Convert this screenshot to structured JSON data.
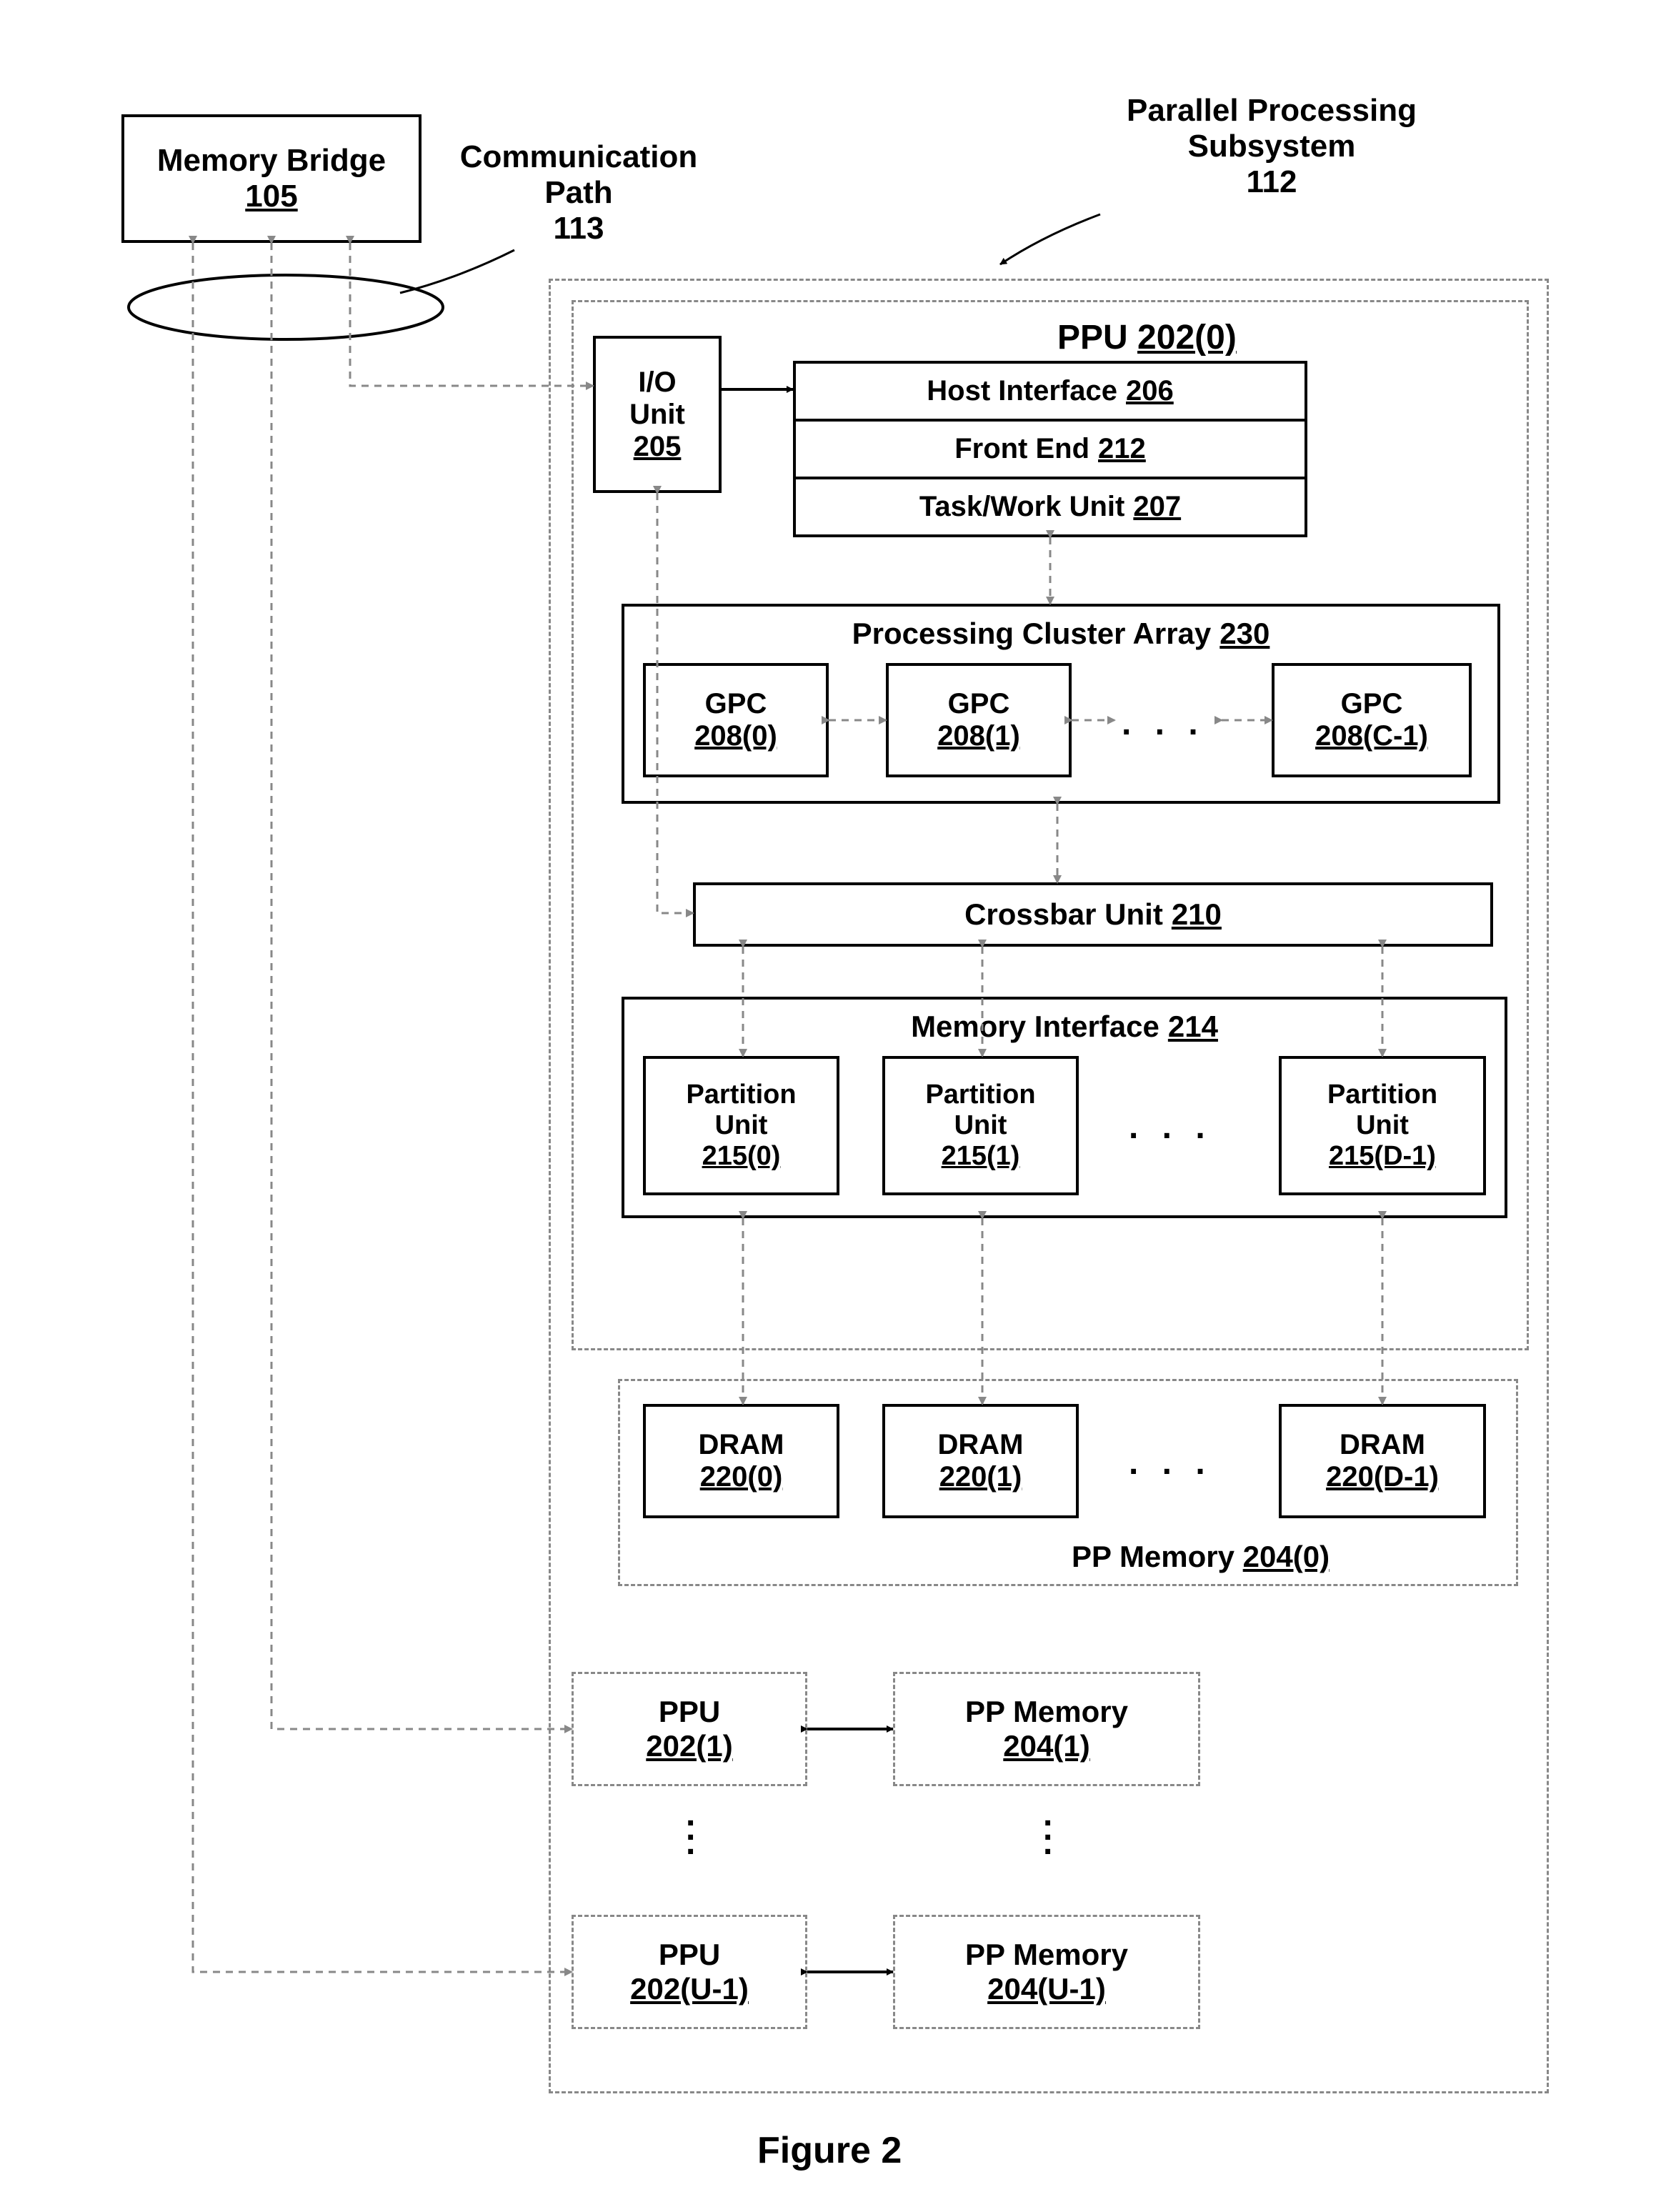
{
  "memory_bridge": {
    "label": "Memory Bridge",
    "num": "105"
  },
  "comm_path": {
    "label": "Communication",
    "label2": "Path",
    "num": "113"
  },
  "pp_subsystem": {
    "label": "Parallel Processing",
    "label2": "Subsystem",
    "num": "112"
  },
  "ppu0": {
    "label": "PPU",
    "num": "202(0)"
  },
  "io_unit": {
    "label": "I/O",
    "label2": "Unit",
    "num": "205"
  },
  "host_if": {
    "label": "Host Interface",
    "num": "206"
  },
  "front_end": {
    "label": "Front End",
    "num": "212"
  },
  "task_work": {
    "label": "Task/Work Unit",
    "num": "207"
  },
  "pca": {
    "label": "Processing Cluster Array",
    "num": "230"
  },
  "gpc0": {
    "label": "GPC",
    "num": "208(0)"
  },
  "gpc1": {
    "label": "GPC",
    "num": "208(1)"
  },
  "gpcC": {
    "label": "GPC",
    "num": "208(C-1)"
  },
  "crossbar": {
    "label": "Crossbar Unit",
    "num": "210"
  },
  "mem_if": {
    "label": "Memory Interface",
    "num": "214"
  },
  "pu0": {
    "label": "Partition",
    "label2": "Unit",
    "num": "215(0)"
  },
  "pu1": {
    "label": "Partition",
    "label2": "Unit",
    "num": "215(1)"
  },
  "puD": {
    "label": "Partition",
    "label2": "Unit",
    "num": "215(D-1)"
  },
  "dram0": {
    "label": "DRAM",
    "num": "220(0)"
  },
  "dram1": {
    "label": "DRAM",
    "num": "220(1)"
  },
  "dramD": {
    "label": "DRAM",
    "num": "220(D-1)"
  },
  "ppmem0": {
    "label": "PP Memory",
    "num": "204(0)"
  },
  "ppu1": {
    "label": "PPU",
    "num": "202(1)"
  },
  "ppmem1": {
    "label": "PP Memory",
    "num": "204(1)"
  },
  "ppuU": {
    "label": "PPU",
    "num": "202(U-1)"
  },
  "ppmemU": {
    "label": "PP Memory",
    "num": "204(U-1)"
  },
  "figure": "Figure 2"
}
